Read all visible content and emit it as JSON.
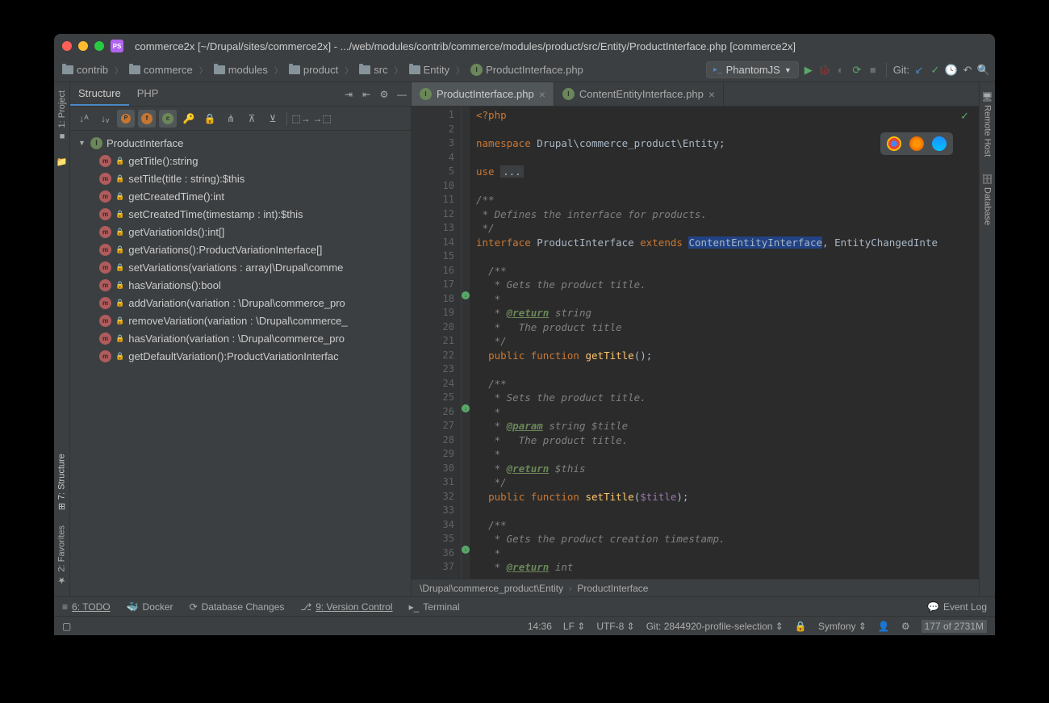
{
  "title": "commerce2x [~/Drupal/sites/commerce2x] - .../web/modules/contrib/commerce/modules/product/src/Entity/ProductInterface.php [commerce2x]",
  "breadcrumbs": [
    "contrib",
    "commerce",
    "modules",
    "product",
    "src",
    "Entity",
    "ProductInterface.php"
  ],
  "run_config": "PhantomJS",
  "git_label": "Git:",
  "tabs": {
    "structure": "Structure",
    "php": "PHP"
  },
  "left_rail": {
    "project": "1: Project",
    "structure": "7: Structure",
    "favorites": "2: Favorites"
  },
  "right_rail": {
    "remote": "Remote Host",
    "database": "Database"
  },
  "root": "ProductInterface",
  "methods": [
    "getTitle():string",
    "setTitle(title : string):$this",
    "getCreatedTime():int",
    "setCreatedTime(timestamp : int):$this",
    "getVariationIds():int[]",
    "getVariations():ProductVariationInterface[]",
    "setVariations(variations : array|\\Drupal\\comme",
    "hasVariations():bool",
    "addVariation(variation : \\Drupal\\commerce_pro",
    "removeVariation(variation : \\Drupal\\commerce_",
    "hasVariation(variation : \\Drupal\\commerce_pro",
    "getDefaultVariation():ProductVariationInterfac"
  ],
  "editor_tabs": [
    {
      "name": "ProductInterface.php",
      "active": true
    },
    {
      "name": "ContentEntityInterface.php",
      "active": false
    }
  ],
  "first_line": 1,
  "last_line": 37,
  "code_lines": [
    {
      "h": "<span class=\"k\">&lt;?php</span>"
    },
    {
      "h": ""
    },
    {
      "h": "<span class=\"k\">namespace</span> <span class=\"ns\">Drupal\\commerce_product\\Entity</span>;"
    },
    {
      "h": ""
    },
    {
      "h": "<span class=\"k\">use</span> <span style=\"background:#3c3f41;padding:0 3px\">...</span>"
    },
    {
      "h": ""
    },
    {
      "h": "<span class=\"c\">/**</span>"
    },
    {
      "h": "<span class=\"c\"> * Defines the interface for products.</span>"
    },
    {
      "h": "<span class=\"c\"> */</span>"
    },
    {
      "h": "<span class=\"k\">interface</span> <span class=\"cl\">ProductInterface</span> <span class=\"k\">extends</span> <span class=\"sel\">ContentEntityInterface</span>, EntityChangedInte"
    },
    {
      "h": ""
    },
    {
      "h": "  <span class=\"c\">/**</span>"
    },
    {
      "h": "  <span class=\"c\"> * Gets the product title.</span>"
    },
    {
      "h": "  <span class=\"c\"> *</span>"
    },
    {
      "h": "  <span class=\"c\"> * <span class=\"tag\">@return</span> string</span>"
    },
    {
      "h": "  <span class=\"c\"> *   The product title</span>"
    },
    {
      "h": "  <span class=\"c\"> */</span>"
    },
    {
      "h": "  <span class=\"k\">public</span> <span class=\"k\">function</span> <span class=\"fn\">getTitle</span>();"
    },
    {
      "h": ""
    },
    {
      "h": "  <span class=\"c\">/**</span>"
    },
    {
      "h": "  <span class=\"c\"> * Sets the product title.</span>"
    },
    {
      "h": "  <span class=\"c\"> *</span>"
    },
    {
      "h": "  <span class=\"c\"> * <span class=\"tag\">@param</span> string $title</span>"
    },
    {
      "h": "  <span class=\"c\"> *   The product title.</span>"
    },
    {
      "h": "  <span class=\"c\"> *</span>"
    },
    {
      "h": "  <span class=\"c\"> * <span class=\"tag\">@return</span> $this</span>"
    },
    {
      "h": "  <span class=\"c\"> */</span>"
    },
    {
      "h": "  <span class=\"k\">public</span> <span class=\"k\">function</span> <span class=\"fn\">setTitle</span>(<span class=\"v\">$title</span>);"
    },
    {
      "h": ""
    },
    {
      "h": "  <span class=\"c\">/**</span>"
    },
    {
      "h": "  <span class=\"c\"> * Gets the product creation timestamp.</span>"
    },
    {
      "h": "  <span class=\"c\"> *</span>"
    },
    {
      "h": "  <span class=\"c\"> * <span class=\"tag\">@return</span> int</span>"
    }
  ],
  "breadcrumb_bottom": {
    "ns": "\\Drupal\\commerce_product\\Entity",
    "cls": "ProductInterface",
    "sep": "›"
  },
  "bottom": {
    "todo": "6: TODO",
    "docker": "Docker",
    "db": "Database Changes",
    "vc": "9: Version Control",
    "term": "Terminal",
    "event": "Event Log"
  },
  "status": {
    "pos": "14:36",
    "le": "LF",
    "enc": "UTF-8",
    "git": "Git: 2844920-profile-selection",
    "fw": "Symfony",
    "mem": "177 of 2731M"
  }
}
